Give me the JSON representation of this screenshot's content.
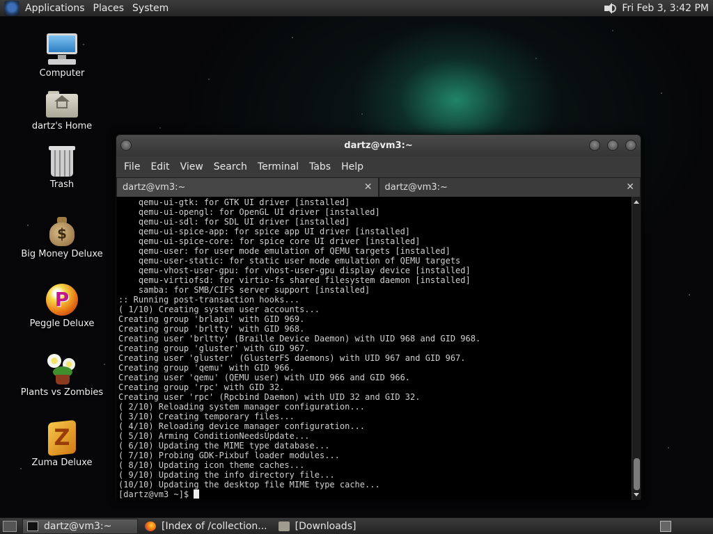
{
  "top_panel": {
    "menus": [
      "Applications",
      "Places",
      "System"
    ],
    "clock": "Fri Feb  3,  3:42 PM"
  },
  "desktop_icons": [
    {
      "label": "Computer",
      "icon": "computer-icon"
    },
    {
      "label": "dartz's Home",
      "icon": "home-folder-icon"
    },
    {
      "label": "Trash",
      "icon": "trash-icon"
    },
    {
      "label": "Big Money Deluxe",
      "icon": "money-bag-icon"
    },
    {
      "label": "Peggle Deluxe",
      "icon": "peggle-icon"
    },
    {
      "label": "Plants vs Zombies",
      "icon": "plants-icon"
    },
    {
      "label": "Zuma Deluxe",
      "icon": "zuma-icon"
    }
  ],
  "terminal": {
    "title": "dartz@vm3:~",
    "menu": [
      "File",
      "Edit",
      "View",
      "Search",
      "Terminal",
      "Tabs",
      "Help"
    ],
    "tabs": [
      {
        "label": "dartz@vm3:~",
        "active": true
      },
      {
        "label": "dartz@vm3:~",
        "active": false
      }
    ],
    "close_glyph": "✕",
    "lines": [
      "    qemu-ui-gtk: for GTK UI driver [installed]",
      "    qemu-ui-opengl: for OpenGL UI driver [installed]",
      "    qemu-ui-sdl: for SDL UI driver [installed]",
      "    qemu-ui-spice-app: for spice app UI driver [installed]",
      "    qemu-ui-spice-core: for spice core UI driver [installed]",
      "    qemu-user: for user mode emulation of QEMU targets [installed]",
      "    qemu-user-static: for static user mode emulation of QEMU targets",
      "    qemu-vhost-user-gpu: for vhost-user-gpu display device [installed]",
      "    qemu-virtiofsd: for virtio-fs shared filesystem daemon [installed]",
      "    samba: for SMB/CIFS server support [installed]",
      ":: Running post-transaction hooks...",
      "( 1/10) Creating system user accounts...",
      "Creating group 'brlapi' with GID 969.",
      "Creating group 'brltty' with GID 968.",
      "Creating user 'brltty' (Braille Device Daemon) with UID 968 and GID 968.",
      "Creating group 'gluster' with GID 967.",
      "Creating user 'gluster' (GlusterFS daemons) with UID 967 and GID 967.",
      "Creating group 'qemu' with GID 966.",
      "Creating user 'qemu' (QEMU user) with UID 966 and GID 966.",
      "Creating group 'rpc' with GID 32.",
      "Creating user 'rpc' (Rpcbind Daemon) with UID 32 and GID 32.",
      "( 2/10) Reloading system manager configuration...",
      "( 3/10) Creating temporary files...",
      "( 4/10) Reloading device manager configuration...",
      "( 5/10) Arming ConditionNeedsUpdate...",
      "( 6/10) Updating the MIME type database...",
      "( 7/10) Probing GDK-Pixbuf loader modules...",
      "( 8/10) Updating icon theme caches...",
      "( 9/10) Updating the info directory file...",
      "(10/10) Updating the desktop file MIME type cache..."
    ],
    "prompt": "[dartz@vm3 ~]$ "
  },
  "taskbar": {
    "tasks": [
      {
        "label": "dartz@vm3:~",
        "icon": "terminal-icon",
        "active": true
      },
      {
        "label": "[Index of /collection...",
        "icon": "firefox-icon",
        "active": false
      },
      {
        "label": "[Downloads]",
        "icon": "folder-icon",
        "active": false
      }
    ]
  }
}
